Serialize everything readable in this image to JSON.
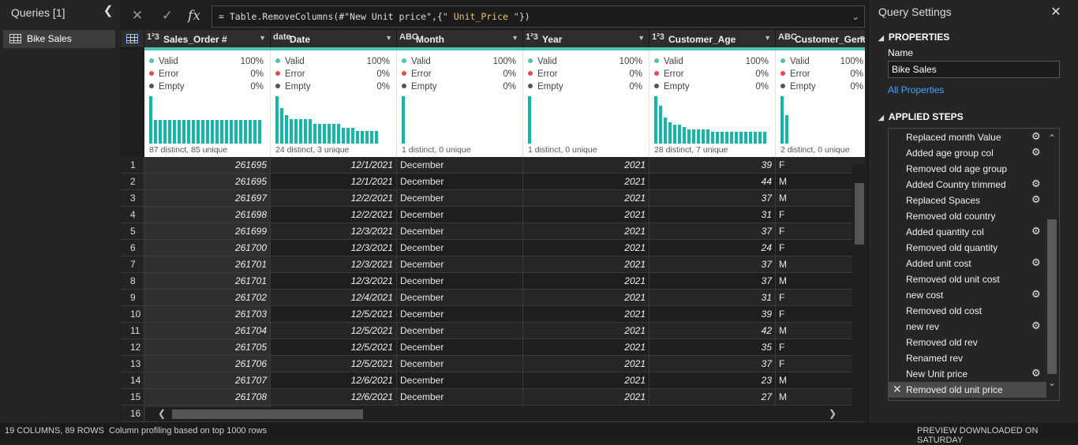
{
  "queries": {
    "title": "Queries [1]",
    "collapse_icon": "chevron-left-icon",
    "items": [
      {
        "label": "Bike Sales",
        "icon": "table-icon"
      }
    ]
  },
  "formula": {
    "cancel_icon": "close-icon",
    "commit_icon": "check-icon",
    "fx_label": "fx",
    "prefix": "= Table.RemoveColumns(#\"New Unit price\",{",
    "string_part": "\" Unit_Price \"",
    "suffix": "})",
    "expand_icon": "chevron-down-icon"
  },
  "grid": {
    "quality_labels": {
      "valid": "Valid",
      "error": "Error",
      "empty": "Empty"
    },
    "colors": {
      "valid": "#4ec4b4",
      "error": "#e05252",
      "empty": "#555555",
      "bar": "#14b8a6"
    },
    "columns": [
      {
        "type": "1²3",
        "name": "Sales_Order #",
        "valid": "100%",
        "error": "0%",
        "empty": "0%",
        "stat": "87 distinct, 85 unique",
        "bars": [
          1,
          0.5,
          0.5,
          0.5,
          0.5,
          0.5,
          0.5,
          0.5,
          0.5,
          0.5,
          0.5,
          0.5,
          0.5,
          0.5,
          0.5,
          0.5,
          0.5,
          0.5,
          0.5,
          0.5,
          0.5,
          0.5,
          0.5,
          0.5
        ]
      },
      {
        "type": "date",
        "name": "Date",
        "valid": "100%",
        "error": "0%",
        "empty": "0%",
        "stat": "24 distinct, 3 unique",
        "bars": [
          1,
          0.75,
          0.6,
          0.52,
          0.52,
          0.52,
          0.52,
          0.52,
          0.42,
          0.42,
          0.42,
          0.42,
          0.42,
          0.42,
          0.34,
          0.34,
          0.34,
          0.26,
          0.26,
          0.26,
          0.26,
          0.26
        ]
      },
      {
        "type": "ABC",
        "name": "Month",
        "valid": "100%",
        "error": "0%",
        "empty": "0%",
        "stat": "1 distinct, 0 unique",
        "bars": [
          1
        ]
      },
      {
        "type": "1²3",
        "name": "Year",
        "valid": "100%",
        "error": "0%",
        "empty": "0%",
        "stat": "1 distinct, 0 unique",
        "bars": [
          1
        ]
      },
      {
        "type": "1²3",
        "name": "Customer_Age",
        "valid": "100%",
        "error": "0%",
        "empty": "0%",
        "stat": "28 distinct, 7 unique",
        "bars": [
          1,
          0.8,
          0.55,
          0.45,
          0.4,
          0.4,
          0.35,
          0.3,
          0.3,
          0.3,
          0.3,
          0.3,
          0.25,
          0.25,
          0.25,
          0.25,
          0.25,
          0.25,
          0.25,
          0.25,
          0.25,
          0.25,
          0.25,
          0.25
        ]
      },
      {
        "type": "ABC",
        "name": "Customer_Gender",
        "valid": "100%",
        "error": "0%",
        "empty": "0%",
        "stat": "2 distinct, 0 unique",
        "bars": [
          1,
          0.6
        ]
      }
    ],
    "rows": [
      [
        "1",
        "261695",
        "12/1/2021",
        "December",
        "2021",
        "39",
        "F"
      ],
      [
        "2",
        "261695",
        "12/1/2021",
        "December",
        "2021",
        "44",
        "M"
      ],
      [
        "3",
        "261697",
        "12/2/2021",
        "December",
        "2021",
        "37",
        "M"
      ],
      [
        "4",
        "261698",
        "12/2/2021",
        "December",
        "2021",
        "31",
        "F"
      ],
      [
        "5",
        "261699",
        "12/3/2021",
        "December",
        "2021",
        "37",
        "F"
      ],
      [
        "6",
        "261700",
        "12/3/2021",
        "December",
        "2021",
        "24",
        "F"
      ],
      [
        "7",
        "261701",
        "12/3/2021",
        "December",
        "2021",
        "37",
        "M"
      ],
      [
        "8",
        "261701",
        "12/3/2021",
        "December",
        "2021",
        "37",
        "M"
      ],
      [
        "9",
        "261702",
        "12/4/2021",
        "December",
        "2021",
        "31",
        "F"
      ],
      [
        "10",
        "261703",
        "12/5/2021",
        "December",
        "2021",
        "39",
        "F"
      ],
      [
        "11",
        "261704",
        "12/5/2021",
        "December",
        "2021",
        "42",
        "M"
      ],
      [
        "12",
        "261705",
        "12/5/2021",
        "December",
        "2021",
        "35",
        "F"
      ],
      [
        "13",
        "261706",
        "12/5/2021",
        "December",
        "2021",
        "37",
        "F"
      ],
      [
        "14",
        "261707",
        "12/6/2021",
        "December",
        "2021",
        "23",
        "M"
      ],
      [
        "15",
        "261708",
        "12/6/2021",
        "December",
        "2021",
        "27",
        "M"
      ],
      [
        "16",
        "",
        "",
        "",
        "",
        "",
        ""
      ]
    ]
  },
  "settings": {
    "title": "Query Settings",
    "properties_heading": "PROPERTIES",
    "name_label": "Name",
    "name_value": "Bike Sales",
    "all_properties": "All Properties",
    "applied_steps_heading": "APPLIED STEPS",
    "steps": [
      {
        "label": "Replaced month Value",
        "gear": true
      },
      {
        "label": "Added age group col",
        "gear": true
      },
      {
        "label": "Removed old age group",
        "gear": false
      },
      {
        "label": "Added Country trimmed",
        "gear": true
      },
      {
        "label": "Replaced Spaces",
        "gear": true
      },
      {
        "label": "Removed old country",
        "gear": false
      },
      {
        "label": "Added quantity col",
        "gear": true
      },
      {
        "label": "Removed old quantity",
        "gear": false
      },
      {
        "label": "Added unit cost",
        "gear": true
      },
      {
        "label": "Removed old unit cost",
        "gear": false
      },
      {
        "label": "new cost",
        "gear": true
      },
      {
        "label": "Removed old cost",
        "gear": false
      },
      {
        "label": "new rev",
        "gear": true
      },
      {
        "label": "Removed old rev",
        "gear": false
      },
      {
        "label": "Renamed rev",
        "gear": false
      },
      {
        "label": "New Unit price",
        "gear": true
      },
      {
        "label": "Removed old unit price",
        "gear": false,
        "selected": true
      }
    ]
  },
  "status": {
    "left": "19 COLUMNS, 89 ROWS",
    "profiling": "Column profiling based on top 1000 rows",
    "right": "PREVIEW DOWNLOADED ON SATURDAY"
  }
}
